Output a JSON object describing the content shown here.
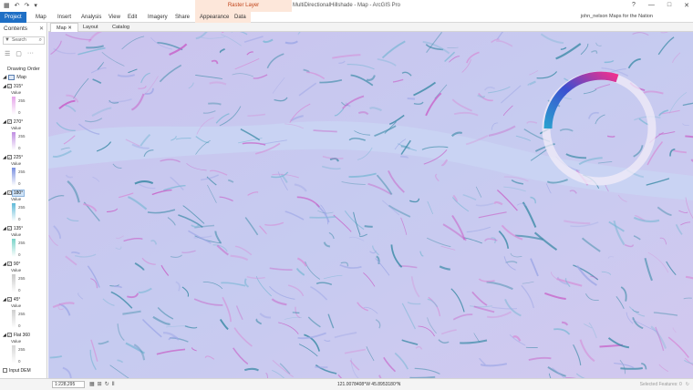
{
  "window": {
    "title": "MultiDirectionalHillshade - Map - ArcGIS Pro",
    "context_group": "Raster Layer",
    "minimize": "—",
    "maximize": "□",
    "close": "✕"
  },
  "qat": [
    "▦",
    "↶",
    "↷",
    "▾"
  ],
  "ribbon": {
    "tabs": [
      "Project",
      "Map",
      "Insert",
      "Analysis",
      "View",
      "Edit",
      "Imagery",
      "Share",
      "Appearance",
      "Data"
    ],
    "user": "john_nelson  Maps for the Nation"
  },
  "contents": {
    "title": "Contents",
    "close": "✕",
    "search_placeholder": "Search",
    "drawing_order": "Drawing Order",
    "map_label": "Map",
    "value_label": "Value",
    "layers": [
      {
        "name": "315°",
        "high": "255",
        "low": "0",
        "color_top": "#e6a5ea",
        "color_bot": "#ffffff"
      },
      {
        "name": "270°",
        "high": "255",
        "low": "0",
        "color_top": "#c08ee2",
        "color_bot": "#ffffff"
      },
      {
        "name": "225°",
        "high": "255",
        "low": "0",
        "color_top": "#7a8fe0",
        "color_bot": "#ffffff"
      },
      {
        "name": "180°",
        "high": "255",
        "low": "0",
        "color_top": "#5fbad8",
        "color_bot": "#ffffff",
        "selected": true
      },
      {
        "name": "135°",
        "high": "255",
        "low": "0",
        "color_top": "#79d3c8",
        "color_bot": "#ffffff"
      },
      {
        "name": "90°",
        "high": "255",
        "low": "0",
        "color_top": "#c9c9c9",
        "color_bot": "#ffffff"
      },
      {
        "name": "45°",
        "high": "255",
        "low": "0",
        "color_top": "#cfcfcf",
        "color_bot": "#ffffff"
      },
      {
        "name": "Flat 360",
        "high": "255",
        "low": "0",
        "color_top": "#d6d6d6",
        "color_bot": "#ffffff"
      }
    ],
    "last_layer": "Input DEM"
  },
  "view_tabs": [
    "Map",
    "Layout",
    "Catalog"
  ],
  "status": {
    "scale": "1:228,295",
    "coordinates": "121.0078408°W 45.8953180°N",
    "right_text": "Selected Features: 0"
  },
  "colors": {
    "project_blue": "#1f6fc5",
    "map_base": "#c7c6ef",
    "ridge_dark": "#3b8aa6",
    "ridge_pink": "#c85cc6",
    "ring_start": "#2aa0cf",
    "ring_mid": "#3b4fd0",
    "ring_end": "#f0308f"
  }
}
